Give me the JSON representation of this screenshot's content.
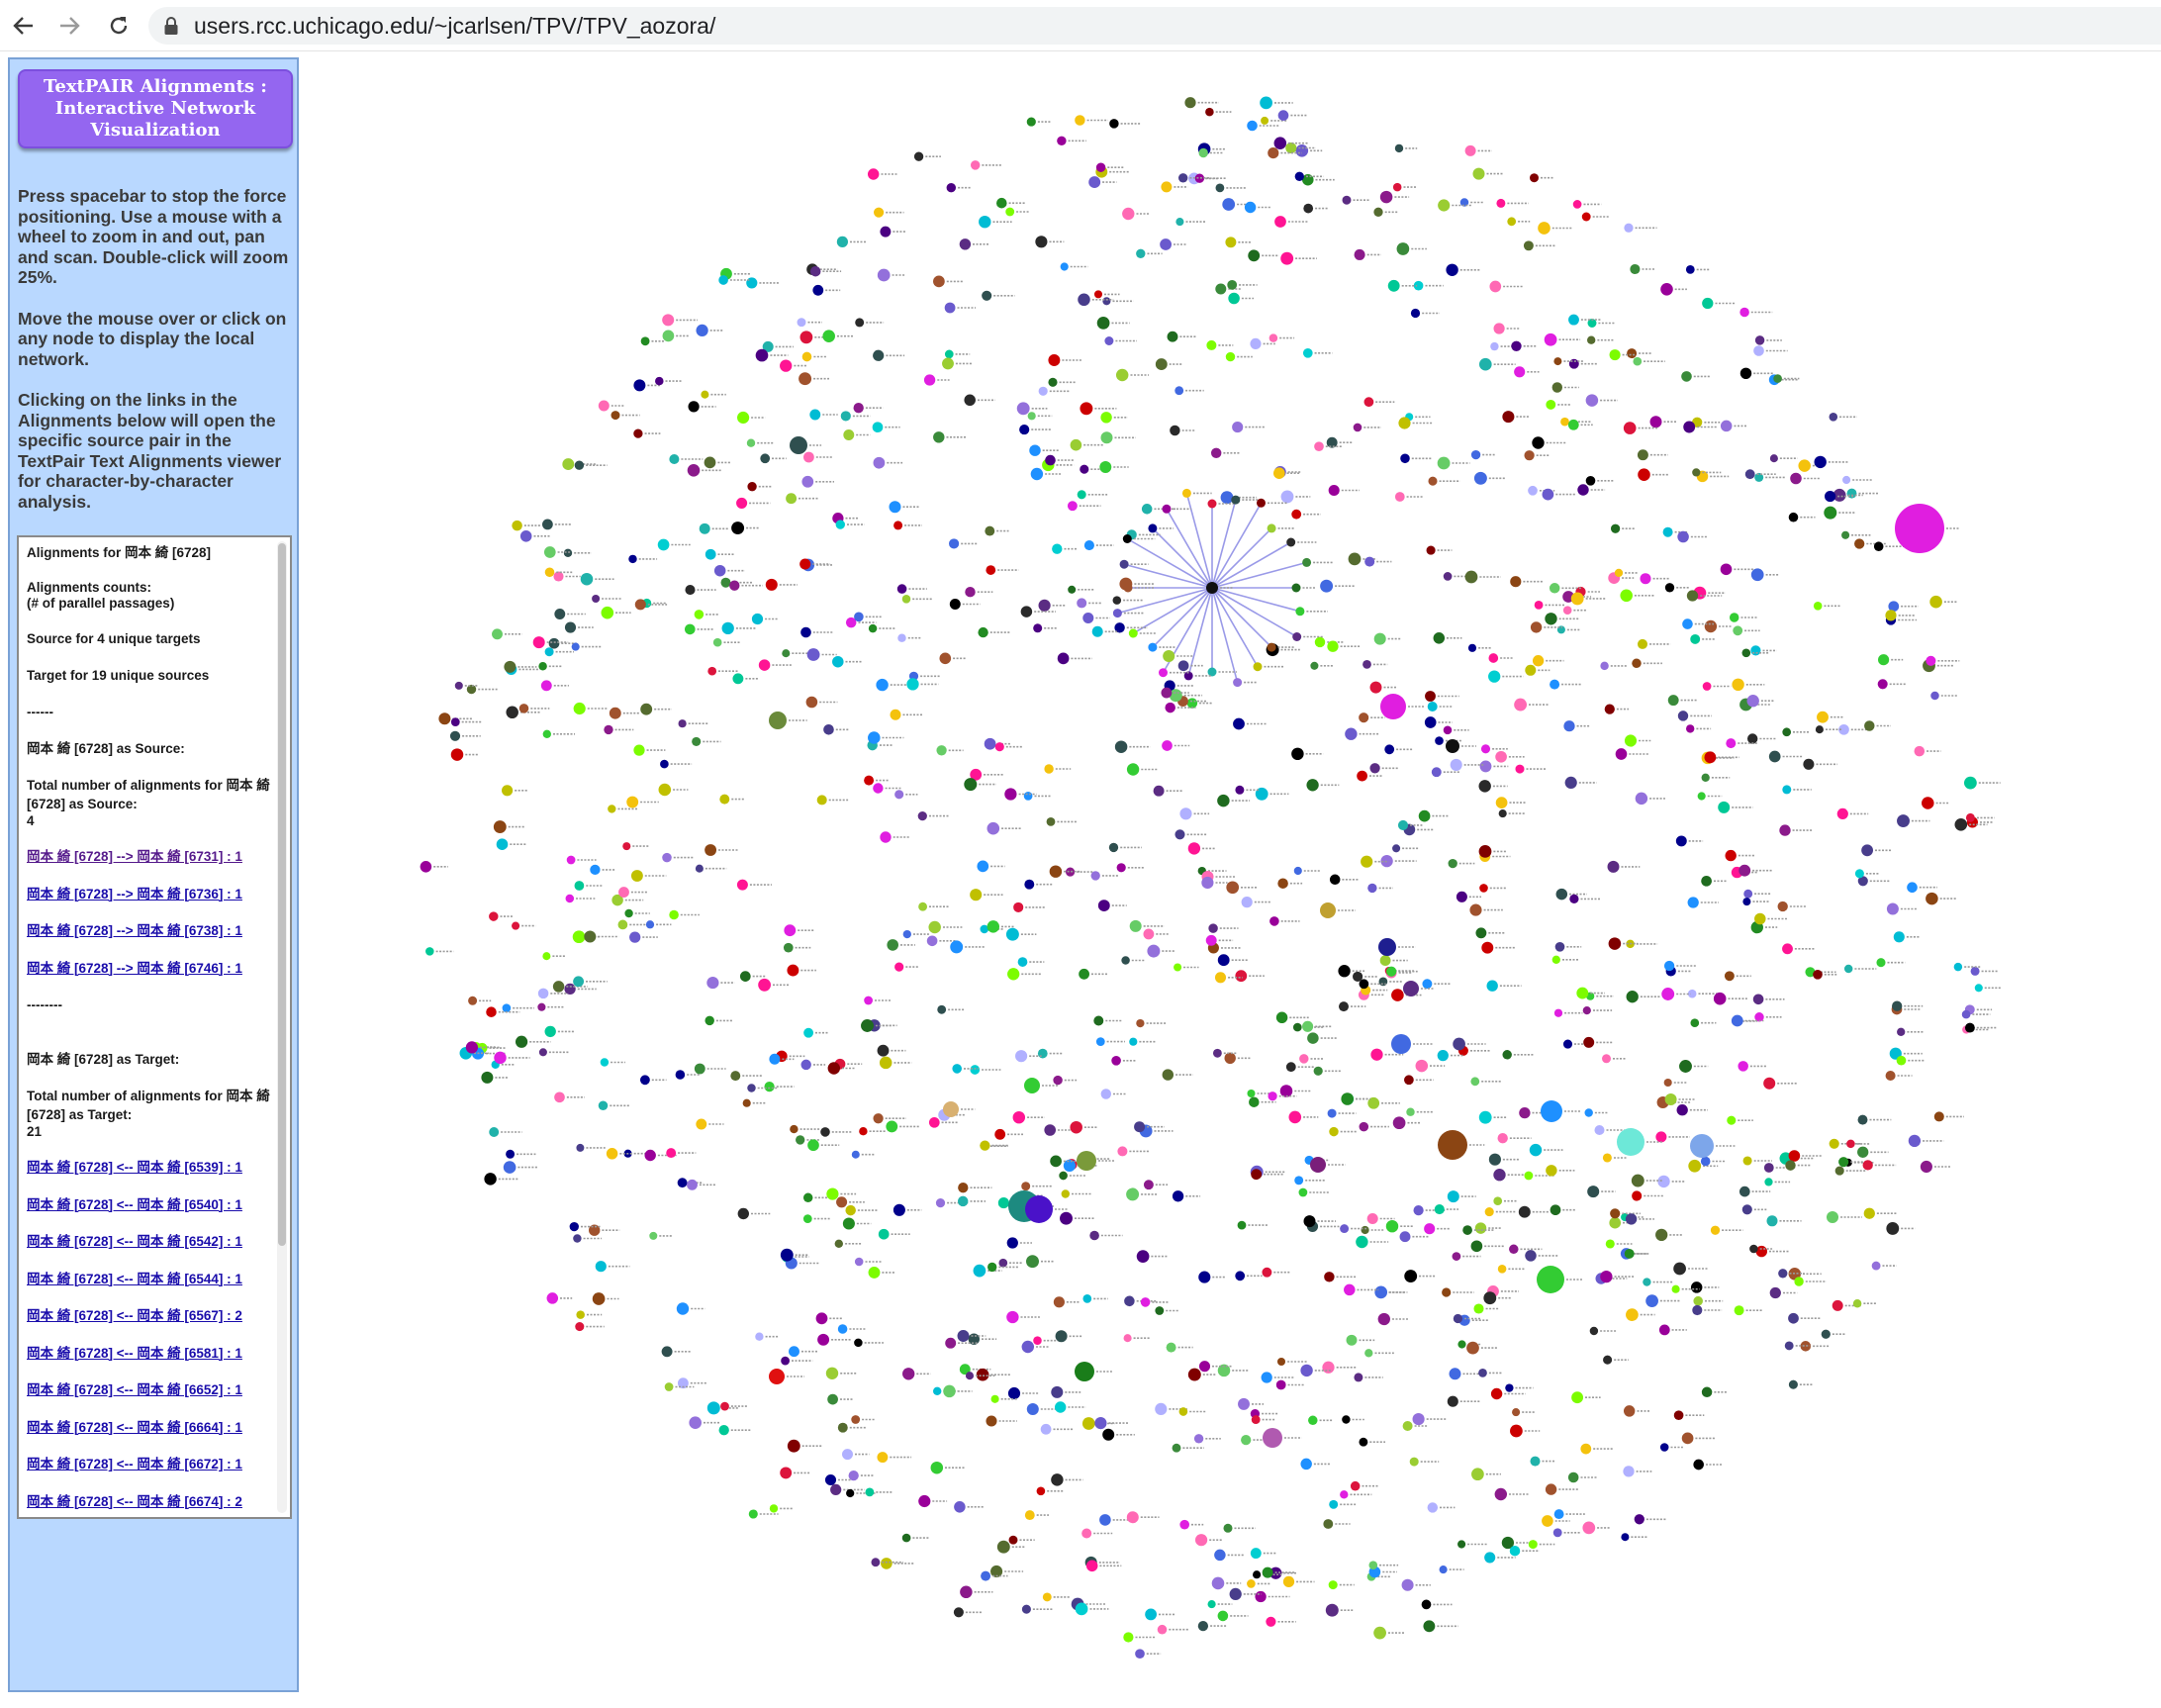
{
  "browser": {
    "back_icon": "arrow-left-icon",
    "forward_icon": "arrow-right-icon",
    "reload_icon": "reload-icon",
    "lock_icon": "lock-icon",
    "url": "users.rcc.uchicago.edu/~jcarlsen/TPV/TPV_aozora/"
  },
  "panel": {
    "title": "TextPAIR Alignments : Interactive Network Visualization",
    "instructions": [
      "Press spacebar to stop the force positioning. Use a mouse with a wheel to zoom in and out, pan and scan. Double-click will zoom 25%.",
      "Move the mouse over or click on any node to display the local network.",
      "Clicking on the links in the Alignments below will open the specific source pair in the TextPair Text Alignments viewer for character-by-character analysis."
    ],
    "alignments": {
      "heading": "Alignments for 岡本 綺 [6728]",
      "counts_label": "Alignments counts:",
      "counts_sub": "(# of parallel passages)",
      "source_summary": "Source for 4 unique targets",
      "target_summary": "Target for 19 unique sources",
      "sep1": "------",
      "as_source_heading": "岡本 綺 [6728] as Source:",
      "total_source_label": "Total number of alignments for 岡本 綺 [6728] as Source:",
      "total_source_value": "4",
      "source_links": [
        "岡本 綺 [6728] --> 岡本 綺 [6731] : 1",
        "岡本 綺 [6728] --> 岡本 綺 [6736] : 1",
        "岡本 綺 [6728] --> 岡本 綺 [6738] : 1",
        "岡本 綺 [6728] --> 岡本 綺 [6746] : 1"
      ],
      "sep2": "--------",
      "as_target_heading": "岡本 綺 [6728] as Target:",
      "total_target_label": "Total number of alignments for 岡本 綺 [6728] as Target:",
      "total_target_value": "21",
      "target_links": [
        "岡本 綺 [6728] <-- 岡本 綺 [6539] : 1",
        "岡本 綺 [6728] <-- 岡本 綺 [6540] : 1",
        "岡本 綺 [6728] <-- 岡本 綺 [6542] : 1",
        "岡本 綺 [6728] <-- 岡本 綺 [6544] : 1",
        "岡本 綺 [6728] <-- 岡本 綺 [6567] : 2",
        "岡本 綺 [6728] <-- 岡本 綺 [6581] : 1",
        "岡本 綺 [6728] <-- 岡本 綺 [6652] : 1",
        "岡本 綺 [6728] <-- 岡本 綺 [6664] : 1",
        "岡本 綺 [6728] <-- 岡本 綺 [6672] : 1",
        "岡本 綺 [6728] <-- 岡本 綺 [6674] : 2"
      ]
    }
  },
  "colors": {
    "panel_bg": "#b9d8ff",
    "title_bg": "#9466f0",
    "link": "#1a0dab",
    "edge": "#9a9ae8",
    "node_palette": [
      "#1f6b1f",
      "#8b1a8b",
      "#2a2a2a",
      "#00008b",
      "#e01ee0",
      "#33cc33",
      "#66cc66",
      "#3a8a3a",
      "#990099",
      "#1e90ff",
      "#5b2c83",
      "#cc0000",
      "#00bcd4",
      "#f4c20d",
      "#7cfc00",
      "#8b4513",
      "#4169e1",
      "#00c896",
      "#dc143c",
      "#6a5acd",
      "#c0c000",
      "#b0b0ff",
      "#ff69b4",
      "#2f4f4f",
      "#a0522d",
      "#9370db",
      "#00ced1",
      "#228b22",
      "#800000",
      "#483d8b",
      "#20b2aa",
      "#ff1493",
      "#556b2f",
      "#9acd32",
      "#000000",
      "#4b0082"
    ]
  }
}
